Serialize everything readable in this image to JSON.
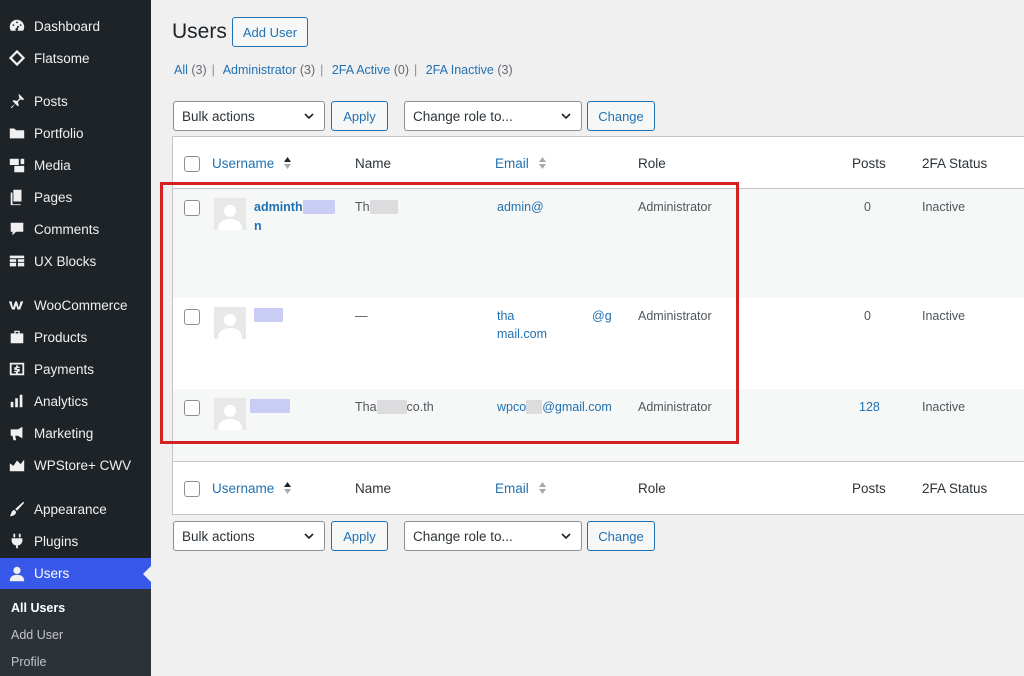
{
  "sidebar": {
    "items": [
      {
        "label": "Dashboard",
        "icon": "dashboard-icon"
      },
      {
        "label": "Flatsome",
        "icon": "flatsome-icon"
      },
      {
        "label": "Posts",
        "icon": "pin-icon"
      },
      {
        "label": "Portfolio",
        "icon": "folder-icon"
      },
      {
        "label": "Media",
        "icon": "media-icon"
      },
      {
        "label": "Pages",
        "icon": "pages-icon"
      },
      {
        "label": "Comments",
        "icon": "comment-icon"
      },
      {
        "label": "UX Blocks",
        "icon": "blocks-icon"
      },
      {
        "label": "WooCommerce",
        "icon": "woo-icon"
      },
      {
        "label": "Products",
        "icon": "products-icon"
      },
      {
        "label": "Payments",
        "icon": "payments-icon"
      },
      {
        "label": "Analytics",
        "icon": "analytics-icon"
      },
      {
        "label": "Marketing",
        "icon": "megaphone-icon"
      },
      {
        "label": "WPStore+ CWV",
        "icon": "chart-icon"
      },
      {
        "label": "Appearance",
        "icon": "brush-icon"
      },
      {
        "label": "Plugins",
        "icon": "plug-icon"
      },
      {
        "label": "Users",
        "icon": "user-icon"
      }
    ],
    "submenu": [
      "All Users",
      "Add User",
      "Profile"
    ]
  },
  "header": {
    "title": "Users",
    "add_button": "Add User"
  },
  "filters": {
    "all": "All",
    "all_count": "(3)",
    "admin": "Administrator",
    "admin_count": "(3)",
    "active": "2FA Active",
    "active_count": "(0)",
    "inactive": "2FA Inactive",
    "inactive_count": "(3)",
    "sep": "|"
  },
  "actions": {
    "bulk": "Bulk actions",
    "apply": "Apply",
    "role": "Change role to...",
    "change": "Change"
  },
  "columns": {
    "username": "Username",
    "name": "Name",
    "email": "Email",
    "role": "Role",
    "posts": "Posts",
    "twofa": "2FA Status"
  },
  "rows": [
    {
      "username_a": "adminth",
      "username_b": "n",
      "name": "Th",
      "email": "admin@",
      "role": "Administrator",
      "posts": "0",
      "status": "Inactive"
    },
    {
      "username_a": "",
      "name": "—",
      "email_a": "tha",
      "email_b": "@g",
      "email_c": "mail.com",
      "role": "Administrator",
      "posts": "0",
      "status": "Inactive"
    },
    {
      "username_a": "",
      "name_a": "Tha",
      "name_b": "co.th",
      "email_a": "wpco",
      "email_b": "@gmail.com",
      "role": "Administrator",
      "posts": "128",
      "status": "Inactive"
    }
  ],
  "colors": {
    "sidebar_bg": "#1d2327",
    "active_bg": "#3858e9",
    "link": "#2271b1",
    "highlight": "#d42121"
  }
}
